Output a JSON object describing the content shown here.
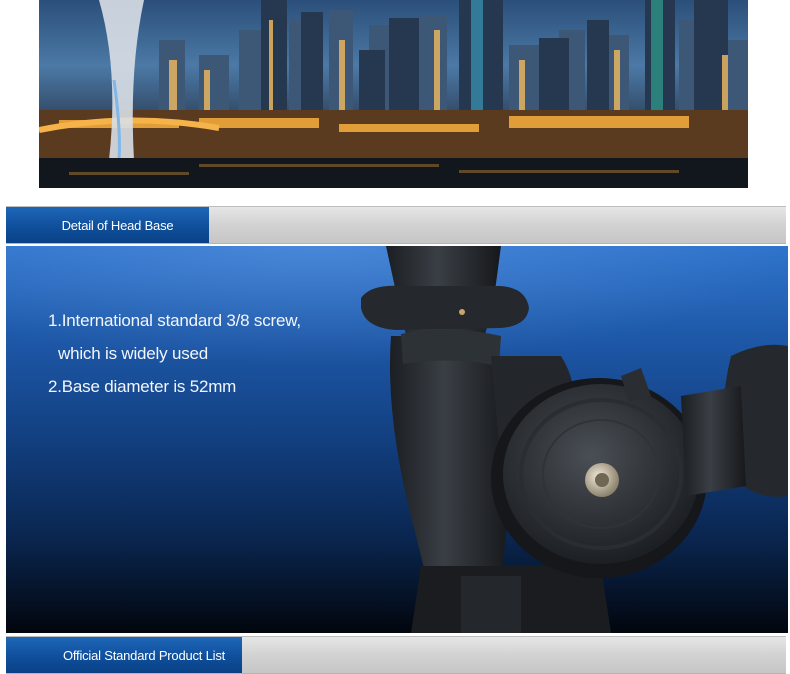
{
  "sections": {
    "head_base": {
      "title": "Detail of Head Base"
    },
    "product_list": {
      "title": "Official Standard Product List"
    }
  },
  "features": [
    "1.International standard 3/8 screw,",
    "which is widely used",
    "2.Base diameter is 52mm"
  ],
  "colors": {
    "tab_blue": "#0f4f9c",
    "bar_gray": "#d2d2d2",
    "panel_blue": "#1d57a6"
  }
}
